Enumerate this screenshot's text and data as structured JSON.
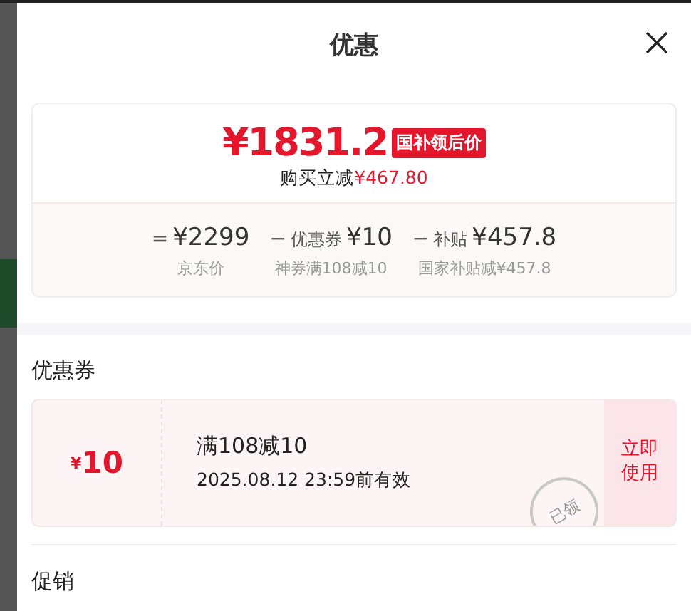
{
  "title": "优惠",
  "summary": {
    "price": "¥1831.2",
    "price_tag": "国补领后价",
    "saving_label": "购买立减",
    "saving_amount": "¥467.80",
    "breakdown": [
      {
        "op": "=",
        "amount": "¥2299",
        "note": "京东价"
      },
      {
        "op": "−",
        "label": "优惠券",
        "amount": "¥10",
        "note": "神券满108减10"
      },
      {
        "op": "−",
        "label": "补贴",
        "amount": "¥457.8",
        "note": "国家补贴减¥457.8"
      }
    ]
  },
  "coupons_heading": "优惠券",
  "coupons": [
    {
      "currency": "¥",
      "value": "10",
      "condition": "满108减10",
      "validity": "2025.08.12 23:59前有效",
      "claimed": true,
      "stamp": "已领",
      "action": "立即使用"
    }
  ],
  "promotions_heading": "促销"
}
